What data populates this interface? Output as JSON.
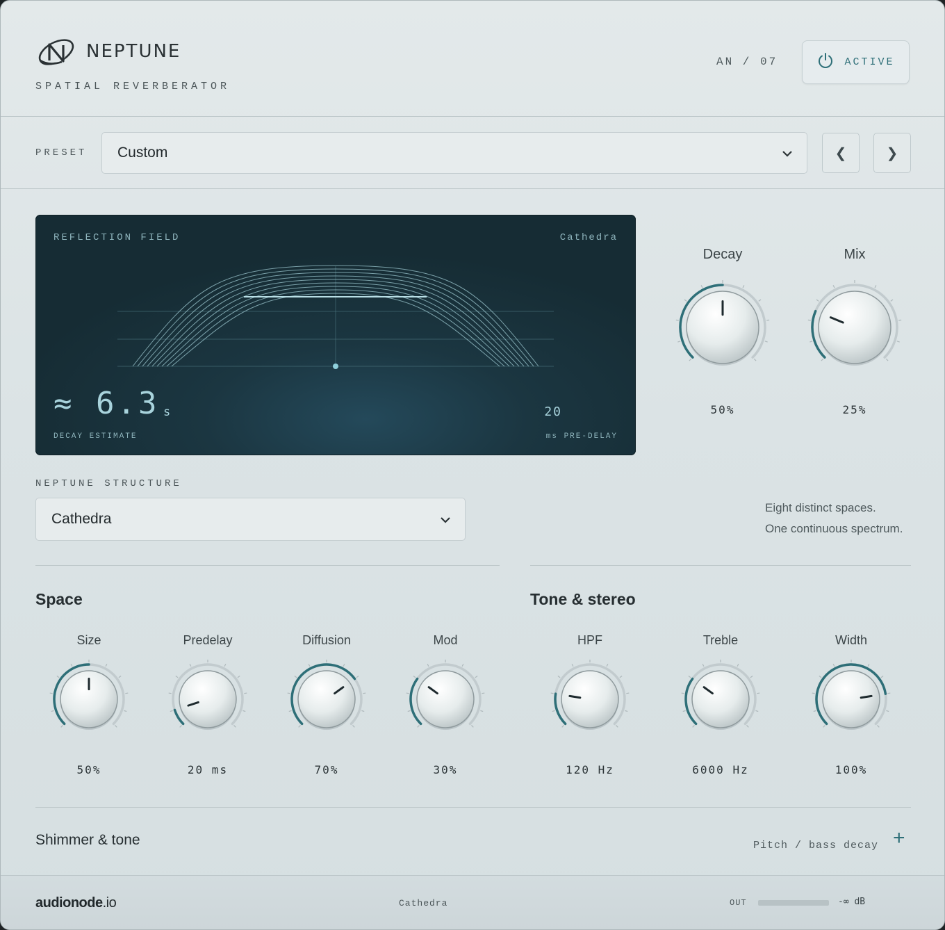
{
  "header": {
    "brand_name": "NEPTUNE",
    "brand_subtitle": "SPATIAL REVERBERATOR",
    "unit_id": "AN / 07",
    "active_label": "ACTIVE"
  },
  "preset": {
    "label": "PRESET",
    "value": "Custom",
    "prev_glyph": "❮",
    "next_glyph": "❯"
  },
  "display": {
    "title": "REFLECTION FIELD",
    "space_name": "Cathedra",
    "decay_prefix": "≈",
    "decay_value": "6.3",
    "decay_unit": "s",
    "decay_caption": "DECAY ESTIMATE",
    "predelay_value": "20",
    "predelay_caption": "ms PRE-DELAY"
  },
  "main_knobs": [
    {
      "label": "Decay",
      "value": "50%",
      "level": 0.5
    },
    {
      "label": "Mix",
      "value": "25%",
      "level": 0.25
    }
  ],
  "structure": {
    "label": "NEPTUNE STRUCTURE",
    "value": "Cathedra",
    "tagline_1": "Eight distinct spaces.",
    "tagline_2": "One continuous spectrum."
  },
  "space": {
    "title": "Space",
    "knobs": [
      {
        "label": "Size",
        "value": "50%",
        "level": 0.5
      },
      {
        "label": "Predelay",
        "value": "20 ms",
        "level": 0.1
      },
      {
        "label": "Diffusion",
        "value": "70%",
        "level": 0.7
      },
      {
        "label": "Mod",
        "value": "30%",
        "level": 0.3
      }
    ]
  },
  "tone": {
    "title": "Tone & stereo",
    "knobs": [
      {
        "label": "HPF",
        "value": "120 Hz",
        "level": 0.2
      },
      {
        "label": "Treble",
        "value": "6000 Hz",
        "level": 0.3
      },
      {
        "label": "Width",
        "value": "100%",
        "level": 0.8
      }
    ]
  },
  "shimmer": {
    "title": "Shimmer & tone",
    "subtitle": "Pitch / bass decay",
    "expand_glyph": "+"
  },
  "footer": {
    "brand_bold": "audionode",
    "brand_suffix": ".io",
    "space_name": "Cathedra",
    "out_label": "OUT",
    "out_value": "-∞ dB"
  },
  "colors": {
    "accent": "#2e6f78",
    "display_bg": "#1b3641",
    "display_text": "#a8d3dc"
  }
}
